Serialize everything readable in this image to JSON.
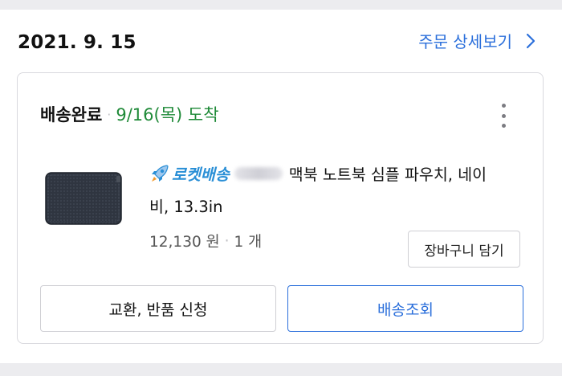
{
  "order": {
    "date": "2021. 9. 15",
    "detail_link_label": "주문 상세보기"
  },
  "card": {
    "status": "배송완료",
    "arrival": "9/16(목) 도착",
    "product": {
      "badge_label": "로켓배송",
      "title_line1": "맥북 노트북 심플 파우치, 네이",
      "title_line2": "비, 13.3in",
      "price": "12,130 원",
      "quantity": "1 개",
      "thumbnail_color": "#2f3540"
    },
    "add_to_cart_label": "장바구니 담기",
    "exchange_return_label": "교환, 반품 신청",
    "track_shipping_label": "배송조회"
  },
  "colors": {
    "accent_blue": "#2b6fdb",
    "status_green": "#1f8a38",
    "rocket_blue": "#2a8fd6"
  },
  "icons": [
    "chevron-right-icon",
    "more-vertical-icon",
    "rocket-icon"
  ]
}
